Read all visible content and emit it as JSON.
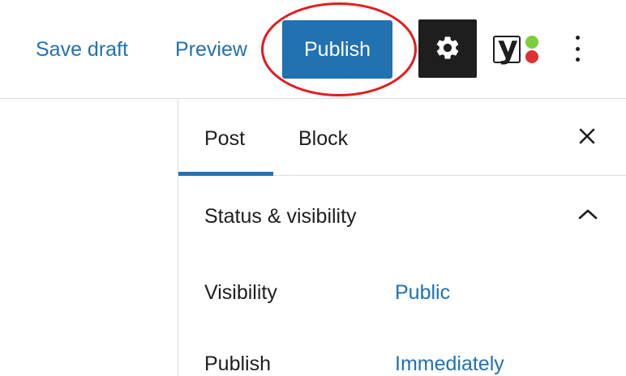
{
  "toolbar": {
    "save_draft_label": "Save draft",
    "preview_label": "Preview",
    "publish_label": "Publish",
    "settings_icon": "gear-icon",
    "yoast_icon": "yoast-seo-icon",
    "yoast_letter": "y",
    "more_icon": "vertical-ellipsis-icon"
  },
  "sidebar": {
    "tabs": [
      {
        "label": "Post",
        "active": true
      },
      {
        "label": "Block",
        "active": false
      }
    ],
    "close_icon": "close-icon",
    "panel": {
      "title": "Status & visibility",
      "expanded": true,
      "rows": [
        {
          "label": "Visibility",
          "value": "Public"
        },
        {
          "label": "Publish",
          "value": "Immediately"
        }
      ]
    }
  },
  "colors": {
    "accent": "#2271b1",
    "highlight_ring": "#e31c1c",
    "settings_bg": "#1e1e1e",
    "yoast_green": "#7ad03a",
    "yoast_red": "#dc3232"
  }
}
